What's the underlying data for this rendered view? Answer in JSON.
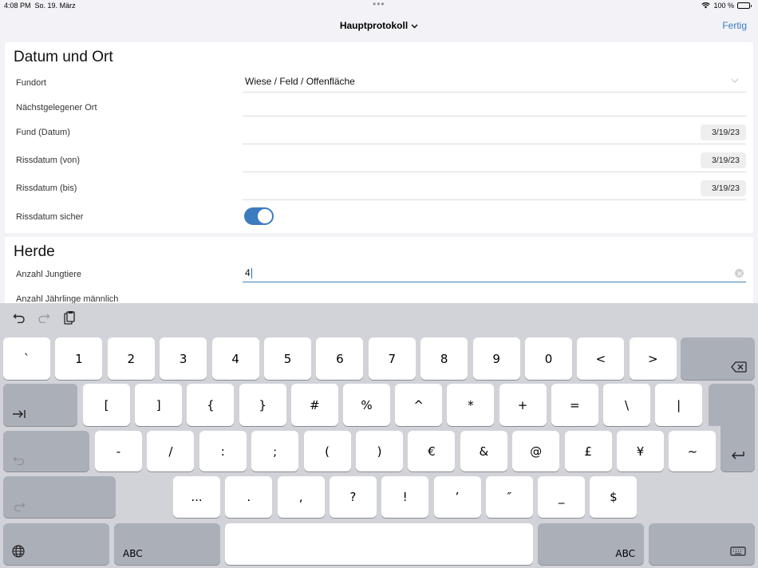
{
  "status": {
    "time": "4:08 PM",
    "date": "So. 19. März",
    "battery": "100 %"
  },
  "nav": {
    "title": "Hauptprotokoll",
    "done": "Fertig"
  },
  "section1": {
    "title": "Datum und Ort",
    "fundort_label": "Fundort",
    "fundort_value": "Wiese / Feld / Offenfläche",
    "naechster_ort_label": "Nächstgelegener Ort",
    "fund_datum_label": "Fund (Datum)",
    "fund_datum_value": "3/19/23",
    "rissdatum_von_label": "Rissdatum (von)",
    "rissdatum_von_value": "3/19/23",
    "rissdatum_bis_label": "Rissdatum (bis)",
    "rissdatum_bis_value": "3/19/23",
    "rissdatum_sicher_label": "Rissdatum sicher",
    "rissdatum_sicher_on": true
  },
  "section2": {
    "title": "Herde",
    "anzahl_jungtiere_label": "Anzahl Jungtiere",
    "anzahl_jungtiere_value": "4",
    "anzahl_jaehrlinge_label": "Anzahl Jährlinge männlich"
  },
  "keyboard": {
    "row1": [
      "`",
      "1",
      "2",
      "3",
      "4",
      "5",
      "6",
      "7",
      "8",
      "9",
      "0",
      "<",
      ">"
    ],
    "row2": [
      "[",
      "]",
      "{",
      "}",
      "#",
      "%",
      "^",
      "*",
      "+",
      "=",
      "\\",
      "|"
    ],
    "row3": [
      "-",
      "/",
      ":",
      ";",
      "(",
      ")",
      "€",
      "&",
      "@",
      "£",
      "¥",
      "~"
    ],
    "row4": [
      "...",
      ".",
      ",",
      "?",
      "!",
      "’",
      "″",
      "_",
      "$"
    ],
    "abc_left": "ABC",
    "abc_right": "ABC"
  }
}
